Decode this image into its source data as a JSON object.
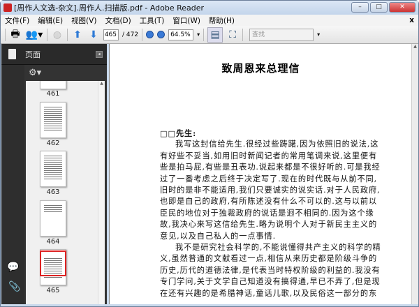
{
  "window": {
    "title": "[周作人文选-杂文].周作人.扫描版.pdf - Adobe Reader",
    "min": "–",
    "max": "□",
    "close": "✕"
  },
  "menu": {
    "items": [
      "文件(F)",
      "编辑(E)",
      "视图(V)",
      "文档(D)",
      "工具(T)",
      "窗口(W)",
      "帮助(H)"
    ],
    "close": "x"
  },
  "toolbar": {
    "page_current": "465",
    "page_total": "/ 472",
    "zoom": "64.5%",
    "find_placeholder": "查找"
  },
  "sidebar": {
    "title": "页面",
    "thumbnails": [
      "461",
      "462",
      "463",
      "464",
      "465"
    ],
    "selected": "465",
    "gear": "⚙▾"
  },
  "document": {
    "title": "致周恩来总理信",
    "lines": [
      "□□先生:",
      "我写这封信给先生.很经过些踌躇,因为依照旧的说法,这",
      "有好些不妥当,如用旧时新闻记者的常用笔调来说,这里便有",
      "些是拍马屁,有些是丑表功.说起来都是不很好听的.可是我经",
      "过了一番考虑之后终于决定写了.现在的时代既与从前不同,",
      "旧时的是非不能适用,我们只要诚实的说实话.对于人民政府,",
      "也即是自己的政府,有所陈述没有什么不可以的.这与以前以",
      "臣民的地位对于独裁政府的说话是迥不相同的.因为这个缘",
      "故,我决心来写这信给先生.略为说明个人对于新民主主义的",
      "意见,以及自己私人的一点事情.",
      "我不是研究社会科学的,不能说懂得共产主义的科学的精",
      "义,虽然普通的文献看过一点,相信从来历史都是阶级斗争的",
      "历史,历代的道德法律,是代表当时特权阶级的利益的.我没有",
      "专门学问,关于文学自己知道没有搞得通,早已不弄了,但是现",
      "在还有兴趣的是希腊神话,童话儿歌,以及民俗这一部分的东"
    ]
  }
}
